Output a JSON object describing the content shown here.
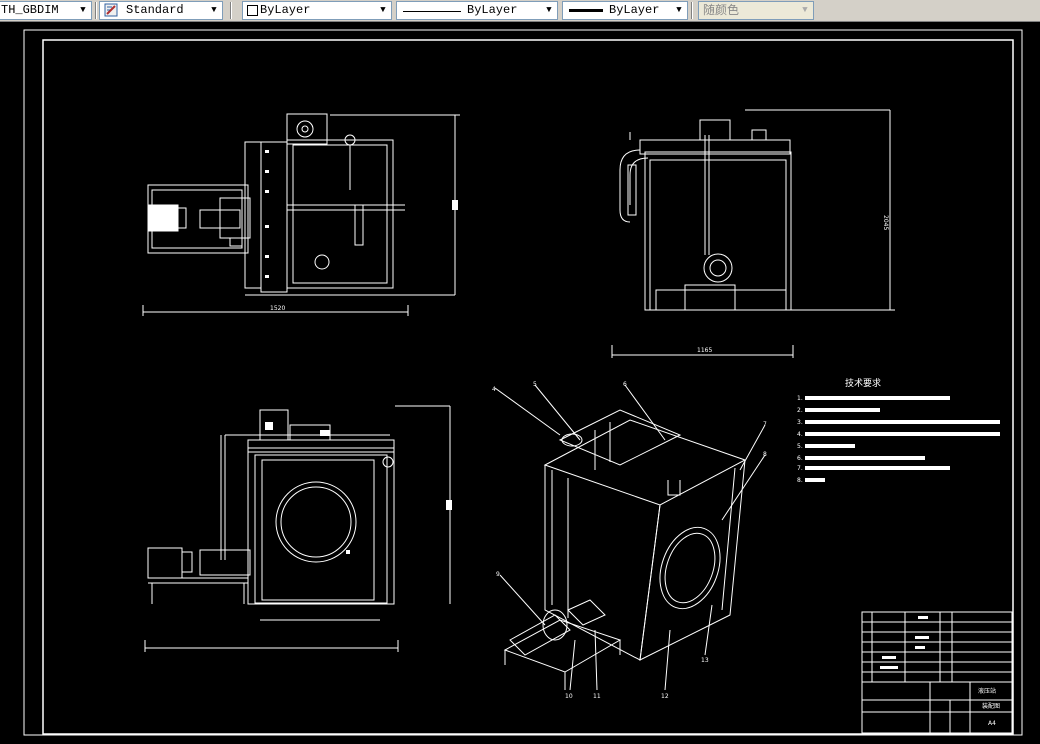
{
  "toolbar": {
    "dimstyle": "TH_GBDIM",
    "textstyle": "Standard",
    "layer": "ByLayer",
    "linetype": "ByLayer",
    "lineweight": "ByLayer",
    "color": "随颜色"
  },
  "drawing": {
    "notes_title": "技术要求",
    "notes": [
      "1.",
      "2.",
      "3.",
      "4.",
      "5.",
      "6.",
      "7.",
      "8."
    ],
    "balloons": [
      "4",
      "5",
      "6",
      "7",
      "8",
      "9",
      "10",
      "11",
      "12",
      "13"
    ],
    "dim_top_view_width": "1520",
    "dim_side_height": "2045",
    "dim_side_width": "1165",
    "title_block_name": "液压站",
    "title_block_sub": "装配图",
    "sheet": "A4"
  }
}
